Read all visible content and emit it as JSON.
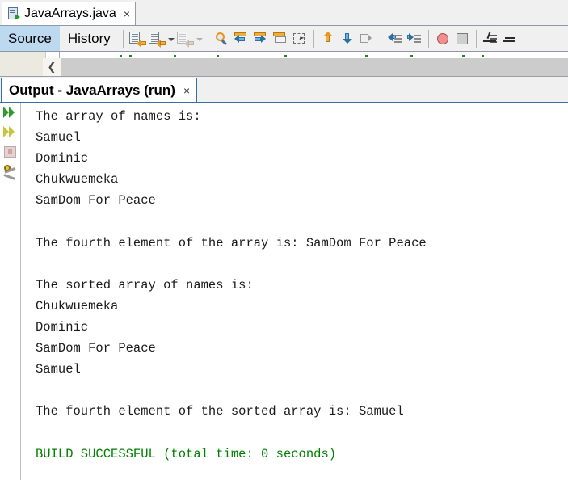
{
  "editor": {
    "file_tab": {
      "label": "JavaArrays.java",
      "close": "×",
      "icon": "java-file-icon"
    },
    "view_tabs": [
      {
        "label": "Source",
        "selected": true
      },
      {
        "label": "History",
        "selected": false
      }
    ],
    "toolbar_buttons": [
      {
        "name": "last-edit-icon",
        "title": "Last Edit"
      },
      {
        "name": "back-icon",
        "title": "Back"
      },
      {
        "name": "back-dropdown-icon",
        "title": "Back dropdown"
      },
      {
        "name": "forward-icon",
        "title": "Forward"
      },
      {
        "name": "forward-dropdown-icon",
        "title": "Forward dropdown"
      },
      {
        "name": "find-selection-icon",
        "title": "Find Selection"
      },
      {
        "name": "find-previous-icon",
        "title": "Find Previous Occurrence"
      },
      {
        "name": "find-next-icon",
        "title": "Find Next Occurrence"
      },
      {
        "name": "toggle-rect-selection-icon",
        "title": "Toggle Rectangular Selection"
      },
      {
        "name": "toggle-highlight-icon",
        "title": "Toggle Highlight Search"
      },
      {
        "name": "previous-bookmark-icon",
        "title": "Previous Bookmark"
      },
      {
        "name": "next-bookmark-icon",
        "title": "Next Bookmark"
      },
      {
        "name": "toggle-bookmark-icon",
        "title": "Toggle Bookmark"
      },
      {
        "name": "shift-left-icon",
        "title": "Shift Line Left"
      },
      {
        "name": "shift-right-icon",
        "title": "Shift Line Right"
      },
      {
        "name": "toggle-breakpoint-icon",
        "title": "Toggle Breakpoint"
      },
      {
        "name": "stop-icon",
        "title": "Stop"
      },
      {
        "name": "comment-icon",
        "title": "Comment"
      },
      {
        "name": "uncomment-icon",
        "title": "Uncomment"
      }
    ],
    "hscrollbar": {
      "left_arrow": "❮"
    }
  },
  "output": {
    "tab_label": "Output - JavaArrays (run)",
    "tab_close": "×",
    "gutter_buttons": [
      {
        "name": "rerun-icon",
        "title": "Re-run"
      },
      {
        "name": "rerun-alt-icon",
        "title": "Re-run with different parameters"
      },
      {
        "name": "stop-process-icon",
        "title": "Stop process"
      },
      {
        "name": "settings-icon",
        "title": "Settings"
      }
    ],
    "lines": [
      {
        "text": "The array of names is:",
        "style": "normal"
      },
      {
        "text": "Samuel",
        "style": "normal"
      },
      {
        "text": "Dominic",
        "style": "normal"
      },
      {
        "text": "Chukwuemeka",
        "style": "normal"
      },
      {
        "text": "SamDom For Peace",
        "style": "normal"
      },
      {
        "text": "",
        "style": "normal"
      },
      {
        "text": "The fourth element of the array is: SamDom For Peace",
        "style": "normal"
      },
      {
        "text": "",
        "style": "normal"
      },
      {
        "text": "The sorted array of names is:",
        "style": "normal"
      },
      {
        "text": "Chukwuemeka",
        "style": "normal"
      },
      {
        "text": "Dominic",
        "style": "normal"
      },
      {
        "text": "SamDom For Peace",
        "style": "normal"
      },
      {
        "text": "Samuel",
        "style": "normal"
      },
      {
        "text": "",
        "style": "normal"
      },
      {
        "text": "The fourth element of the sorted array is: Samuel",
        "style": "normal"
      },
      {
        "text": "",
        "style": "normal"
      },
      {
        "text": "BUILD SUCCESSFUL (total time: 0 seconds)",
        "style": "build-ok"
      }
    ]
  },
  "colors": {
    "build_success_green": "#008000",
    "selected_tab_blue": "#bcd9f0",
    "output_tab_border": "#3c6ea5",
    "toolbar_background": "#f0f0f0",
    "output_background": "#ffffff",
    "text_color": "#1a1a1a"
  }
}
